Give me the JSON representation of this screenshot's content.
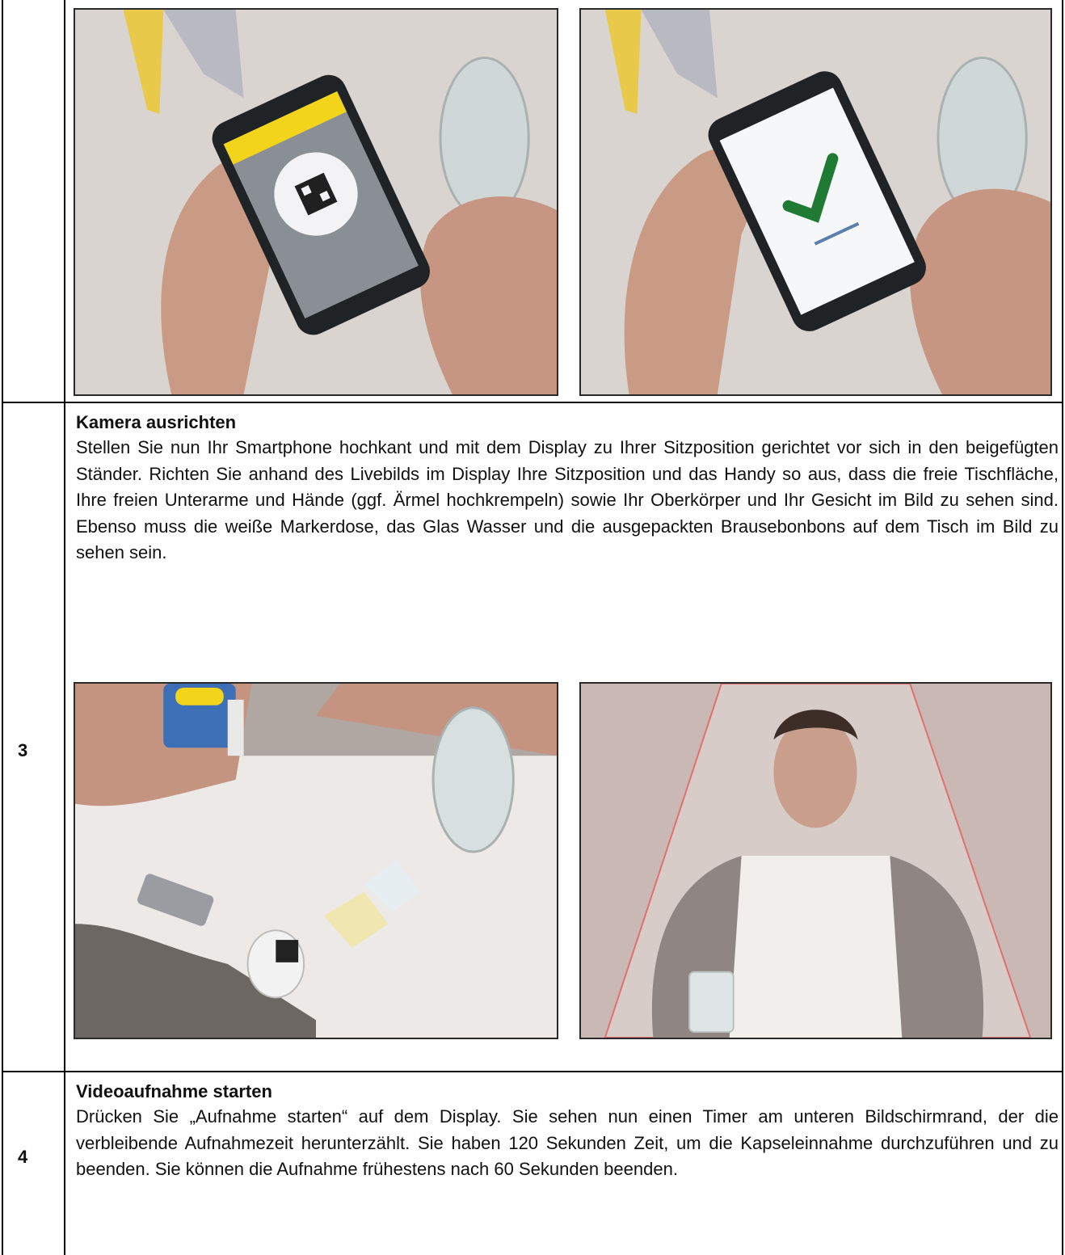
{
  "rows": [
    {
      "number": "",
      "images": [
        {
          "icon": "phone-scanning-qr-code-photo"
        },
        {
          "icon": "phone-qr-code-valid-checkmark-photo"
        }
      ]
    },
    {
      "number": "3",
      "heading": "Kamera ausrichten",
      "text": "Stellen Sie nun Ihr Smartphone hochkant und mit dem Display zu Ihrer Sitzposition gerichtet vor sich in den beigefügten Ständer. Richten Sie anhand des Livebilds im Display Ihre Sitzposition und das Handy so aus, dass die freie Tischfläche, Ihre freien Unterarme und Hände (ggf. Ärmel hochkrempeln) sowie Ihr Oberkörper und Ihr Gesicht im Bild zu sehen sind. Ebenso muss die weiße Markerdose, das Glas Wasser und die ausgepackten Brausebonbons auf dem Tisch im Bild zu sehen sein.",
      "images": [
        {
          "icon": "phone-in-stand-table-photo"
        },
        {
          "icon": "person-camera-view-photo"
        }
      ]
    },
    {
      "number": "4",
      "heading": "Videoaufnahme starten",
      "text": "Drücken Sie „Aufnahme starten“ auf dem Display. Sie sehen nun einen Timer am unteren Bildschirmrand, der die verbleibende Aufnahmezeit herunterzählt. Sie haben 120 Sekunden Zeit, um die Kapseleinnahme durchzuführen und zu beenden. Sie können die Aufnahme frühestens nach 60 Sekunden beenden."
    }
  ]
}
